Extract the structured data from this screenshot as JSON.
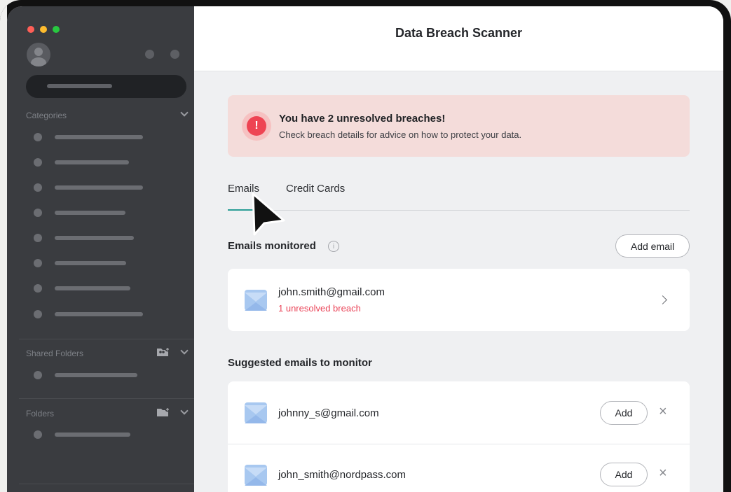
{
  "app": {
    "title": "Data Breach Scanner"
  },
  "sidebar": {
    "sections": {
      "categories_label": "Categories",
      "shared_folders_label": "Shared Folders",
      "folders_label": "Folders"
    }
  },
  "alert": {
    "title": "You have 2 unresolved breaches!",
    "text": "Check breach details for advice on how to protect your data.",
    "icon_glyph": "!"
  },
  "tabs": [
    {
      "label": "Emails",
      "active": true
    },
    {
      "label": "Credit Cards",
      "active": false
    }
  ],
  "monitored": {
    "title": "Emails monitored",
    "add_label": "Add email",
    "emails": [
      {
        "address": "john.smith@gmail.com",
        "status": "1 unresolved breach"
      }
    ]
  },
  "suggested": {
    "title": "Suggested emails to monitor",
    "emails": [
      {
        "address": "johnny_s@gmail.com",
        "add_label": "Add"
      },
      {
        "address": "john_smith@nordpass.com",
        "add_label": "Add"
      }
    ]
  },
  "colors": {
    "accent": "#2a9d96",
    "alert_red": "#ee4453",
    "sidebar_bg": "#3a3c40"
  },
  "icons": {
    "close": "×",
    "info": "i"
  }
}
